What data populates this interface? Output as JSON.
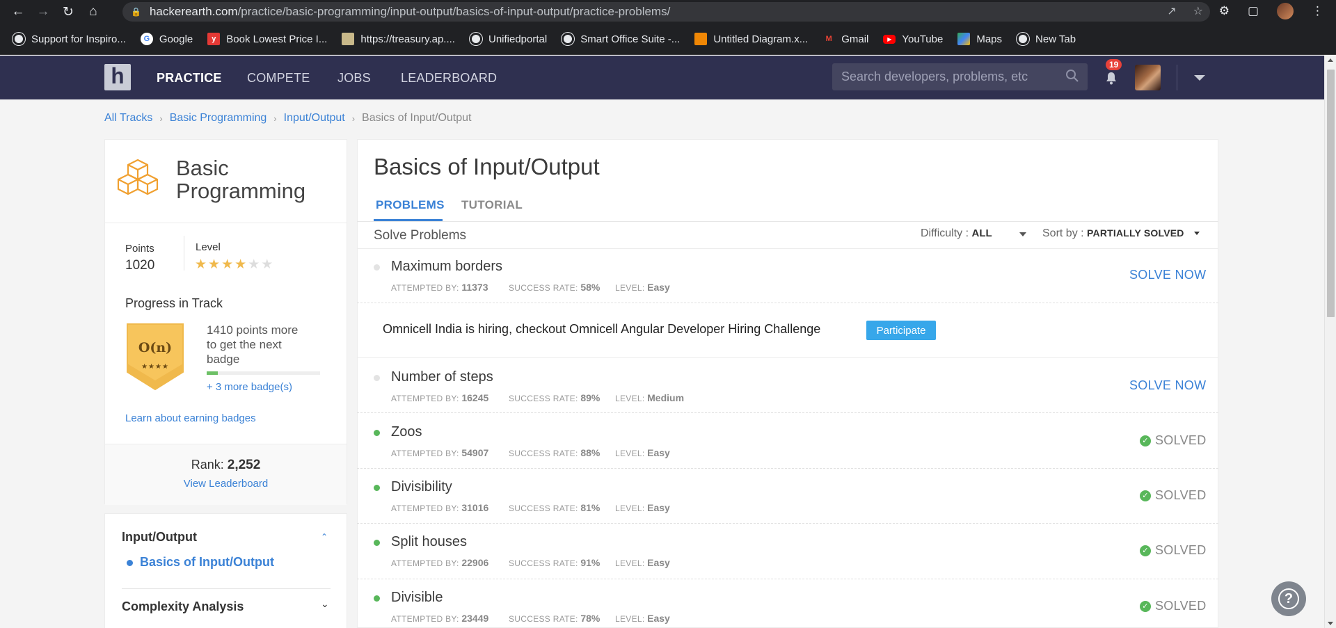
{
  "browser": {
    "url_host": "hackerearth.com",
    "url_path": "/practice/basic-programming/input-output/basics-of-input-output/practice-problems/",
    "bookmarks": [
      {
        "label": "Support for Inspiro...",
        "icon": "globe-icon",
        "color": "#5f6368"
      },
      {
        "label": "Google",
        "icon": "google-icon",
        "color": "#4285f4"
      },
      {
        "label": "Book Lowest Price I...",
        "icon": "yatra-icon",
        "color": "#e53935"
      },
      {
        "label": "https://treasury.ap....",
        "icon": "treasury-icon",
        "color": "#7a6a3a"
      },
      {
        "label": "Unifiedportal",
        "icon": "globe-icon",
        "color": "#5f6368"
      },
      {
        "label": "Smart Office Suite -...",
        "icon": "globe-icon",
        "color": "#5f6368"
      },
      {
        "label": "Untitled Diagram.x...",
        "icon": "drawio-icon",
        "color": "#f08705"
      },
      {
        "label": "Gmail",
        "icon": "gmail-icon",
        "color": "#ea4335"
      },
      {
        "label": "YouTube",
        "icon": "youtube-icon",
        "color": "#ff0000"
      },
      {
        "label": "Maps",
        "icon": "maps-icon",
        "color": "#34a853"
      },
      {
        "label": "New Tab",
        "icon": "globe-icon",
        "color": "#5f6368"
      }
    ]
  },
  "header": {
    "nav": [
      "PRACTICE",
      "COMPETE",
      "JOBS",
      "LEADERBOARD"
    ],
    "search_placeholder": "Search developers, problems, etc",
    "notifications": "19"
  },
  "breadcrumb": [
    "All Tracks",
    "Basic Programming",
    "Input/Output",
    "Basics of Input/Output"
  ],
  "track": {
    "title": "Basic Programming",
    "points_label": "Points",
    "points": "1020",
    "level_label": "Level",
    "level_stars": 4,
    "level_max": 6,
    "progress_label": "Progress in Track",
    "badge_text": "O(n)",
    "badge_stars": "★★★★",
    "next_badge": "1410 points more to get the next badge",
    "progress_fraction": 0.1,
    "more_badges": "+ 3 more badge(s)",
    "learn_link": "Learn about earning badges",
    "rank_label": "Rank:",
    "rank": "2,252",
    "leaderboard_link": "View Leaderboard"
  },
  "sidebar_sections": {
    "section1": "Input/Output",
    "section1_active": "Basics of Input/Output",
    "section2": "Complexity Analysis"
  },
  "main": {
    "title": "Basics of Input/Output",
    "tabs": [
      "PROBLEMS",
      "TUTORIAL"
    ],
    "subheading": "Solve Problems",
    "difficulty_label": "Difficulty :",
    "difficulty_value": "ALL",
    "sort_label": "Sort by :",
    "sort_value": "PARTIALLY SOLVED",
    "labels": {
      "attempted": "ATTEMPTED BY:",
      "success": "SUCCESS RATE:",
      "level": "LEVEL:"
    },
    "solve_now": "SOLVE NOW",
    "solved": "SOLVED",
    "promo_text": "Omnicell India is hiring, checkout Omnicell Angular Developer Hiring Challenge",
    "promo_button": "Participate",
    "problems": [
      {
        "name": "Maximum borders",
        "attempted": "11373",
        "success": "58%",
        "level": "Easy",
        "status": "unsolved"
      },
      {
        "name": "Number of steps",
        "attempted": "16245",
        "success": "89%",
        "level": "Medium",
        "status": "unsolved"
      },
      {
        "name": "Zoos",
        "attempted": "54907",
        "success": "88%",
        "level": "Easy",
        "status": "solved"
      },
      {
        "name": "Divisibility",
        "attempted": "31016",
        "success": "81%",
        "level": "Easy",
        "status": "solved"
      },
      {
        "name": "Split houses",
        "attempted": "22906",
        "success": "91%",
        "level": "Easy",
        "status": "solved"
      },
      {
        "name": "Divisible",
        "attempted": "23449",
        "success": "78%",
        "level": "Easy",
        "status": "solved"
      }
    ]
  },
  "colors": {
    "accent": "#3b82d6",
    "header_bg": "#2f3050",
    "solved": "#58b75a"
  }
}
